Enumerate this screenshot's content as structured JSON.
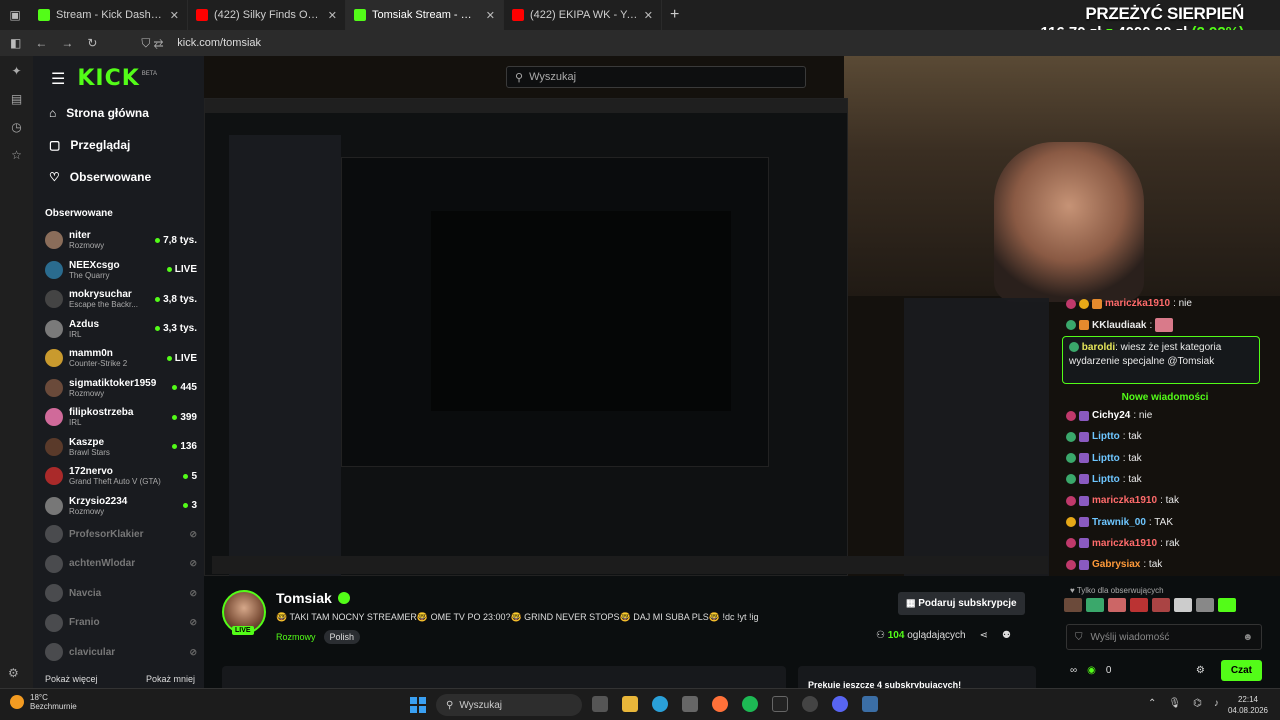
{
  "browser": {
    "tabs": [
      {
        "title": "Stream - Kick Dashboard",
        "color": "#53fc18"
      },
      {
        "title": "(422) Silky Finds Out Jason Use",
        "color": "#ff0000"
      },
      {
        "title": "Tomsiak Stream - Watch Live o",
        "color": "#53fc18",
        "active": true
      },
      {
        "title": "(422) EKIPA WK - YouTube",
        "color": "#ff0000"
      }
    ],
    "url": "kick.com/tomsiak"
  },
  "promo": {
    "line1": "PRZEŻYĆ SIERPIEŃ",
    "amount": "116,70 zł",
    "z": "z",
    "goal": "4000,00 zł",
    "pct": "(2.92%)"
  },
  "sidebar": {
    "logo": "KICK",
    "beta": "BETA",
    "nav": [
      "Strona główna",
      "Przeglądaj",
      "Obserwowane"
    ],
    "section": "Obserwowane",
    "channels": [
      {
        "name": "niter",
        "game": "Rozmowy",
        "viewers": "7,8 tys.",
        "color": "#8a6d5a"
      },
      {
        "name": "NEEXcsgo",
        "game": "The Quarry",
        "viewers": "LIVE",
        "color": "#2a6b8e"
      },
      {
        "name": "mokrysuchar",
        "game": "Escape the Backr...",
        "viewers": "3,8 tys.",
        "color": "#444"
      },
      {
        "name": "Azdus",
        "game": "IRL",
        "viewers": "3,3 tys.",
        "color": "#7a7a7a"
      },
      {
        "name": "mamm0n",
        "game": "Counter-Strike 2",
        "viewers": "LIVE",
        "color": "#c99a2e"
      },
      {
        "name": "sigmatiktoker1959",
        "game": "Rozmowy",
        "viewers": "445",
        "color": "#6a4a3a"
      },
      {
        "name": "filipkostrzeba",
        "game": "IRL",
        "viewers": "399",
        "color": "#d06a9a"
      },
      {
        "name": "Kaszpe",
        "game": "Brawl Stars",
        "viewers": "136",
        "color": "#5a3a2a"
      },
      {
        "name": "172nervo",
        "game": "Grand Theft Auto V (GTA)",
        "viewers": "5",
        "color": "#aa2a2a"
      },
      {
        "name": "Krzysio2234",
        "game": "Rozmowy",
        "viewers": "3",
        "color": "#777"
      }
    ],
    "offline": [
      "ProfesorKlakier",
      "achtenWlodar",
      "Navcia",
      "Franio",
      "clavicular"
    ],
    "more": "Pokaż więcej",
    "less": "Pokaż mniej"
  },
  "search": {
    "placeholder": "Wyszukaj"
  },
  "chat": {
    "messages_top": [
      {
        "user": "mariczka1910",
        "text": ": nie",
        "color": "#ff6b6b",
        "badge": "23"
      },
      {
        "user": "KKlaudiaak",
        "text": ":",
        "color": "#ffffff",
        "badge": "48"
      }
    ],
    "highlight": {
      "badge": "43",
      "user": "baroldi",
      "text": ": wiesz że jest kategoria wydarzenie specjalne @Tomsiak"
    },
    "new_label": "Nowe wiadomości",
    "messages": [
      {
        "user": "Cichy24",
        "text": ": nie",
        "color": "#ffffff",
        "badge": "23"
      },
      {
        "user": "Liptto",
        "text": ": tak",
        "color": "#6ec6ff",
        "badge": "48"
      },
      {
        "user": "Liptto",
        "text": ": tak",
        "color": "#6ec6ff",
        "badge": "48"
      },
      {
        "user": "Liptto",
        "text": ": tak",
        "color": "#6ec6ff",
        "badge": "48"
      },
      {
        "user": "mariczka1910",
        "text": ": tak",
        "color": "#ff6b6b",
        "badge": "23"
      },
      {
        "user": "Trawnik_00",
        "text": ": TAK",
        "color": "#6ec6ff",
        "badge": ""
      },
      {
        "user": "mariczka1910",
        "text": ": rak",
        "color": "#ff6b6b",
        "badge": "23"
      },
      {
        "user": "Gabrysiax",
        "text": ": tak",
        "color": "#ff9a3a",
        "badge": "28"
      }
    ],
    "followers_only": "Tylko dla obserwujących",
    "input_placeholder": "Wyślij wiadomość",
    "points": "0",
    "send_label": "Czat"
  },
  "stream": {
    "name": "Tomsiak",
    "live": "LIVE",
    "title": "🤓 TAKI TAM NOCNY STREAMER🤓 OME TV PO 23:00?🤓 GRIND NEVER STOPS🤓 DAJ MI SUBA PLS🤓 !dc !yt !ig",
    "category": "Rozmowy",
    "tag": "Polish",
    "subscribe": "Podaruj subskrypcje",
    "viewers": "104",
    "viewers_label": "oglądających",
    "gift_text": "Prekuie jeszcze 4 subskrybujących!"
  },
  "taskbar": {
    "temp": "18°C",
    "weather": "Bezchmurnie",
    "search": "Wyszukaj",
    "time": "22:14",
    "date": "04.08.2026"
  }
}
